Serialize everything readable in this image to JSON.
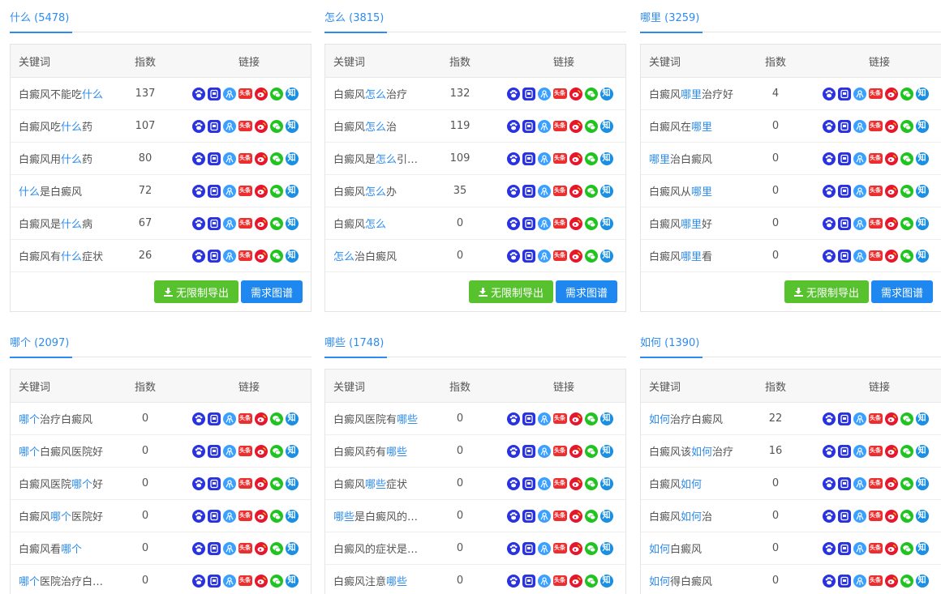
{
  "headers": {
    "keyword": "关键词",
    "index": "指数",
    "links": "链接"
  },
  "buttons": {
    "export": "无限制导出",
    "graph": "需求图谱"
  },
  "icons": [
    "baidu-paw-icon",
    "shenma-icon",
    "360-icon",
    "toutiao-icon",
    "weibo-icon",
    "wechat-icon",
    "zhihu-icon"
  ],
  "icon_glyphs": {
    "toutiao": "头条",
    "zhihu": "知"
  },
  "panels": [
    {
      "tab": "什么 (5478)",
      "term": "什么",
      "rows": [
        {
          "keyword": "白癜风不能吃什么",
          "index": "137"
        },
        {
          "keyword": "白癜风吃什么药",
          "index": "107"
        },
        {
          "keyword": "白癜风用什么药",
          "index": "80"
        },
        {
          "keyword": "什么是白癜风",
          "index": "72"
        },
        {
          "keyword": "白癜风是什么病",
          "index": "67"
        },
        {
          "keyword": "白癜风有什么症状",
          "index": "26"
        }
      ],
      "has_footer": true
    },
    {
      "tab": "怎么 (3815)",
      "term": "怎么",
      "rows": [
        {
          "keyword": "白癜风怎么治疗",
          "index": "132"
        },
        {
          "keyword": "白癜风怎么治",
          "index": "119"
        },
        {
          "keyword": "白癜风是怎么引…",
          "index": "109"
        },
        {
          "keyword": "白癜风怎么办",
          "index": "35"
        },
        {
          "keyword": "白癜风怎么",
          "index": "0"
        },
        {
          "keyword": "怎么治白癜风",
          "index": "0"
        }
      ],
      "has_footer": true
    },
    {
      "tab": "哪里 (3259)",
      "term": "哪里",
      "rows": [
        {
          "keyword": "白癜风哪里治疗好",
          "index": "4"
        },
        {
          "keyword": "白癜风在哪里",
          "index": "0"
        },
        {
          "keyword": "哪里治白癜风",
          "index": "0"
        },
        {
          "keyword": "白癜风从哪里",
          "index": "0"
        },
        {
          "keyword": "白癜风哪里好",
          "index": "0"
        },
        {
          "keyword": "白癜风哪里看",
          "index": "0"
        }
      ],
      "has_footer": true
    },
    {
      "tab": "哪个 (2097)",
      "term": "哪个",
      "rows": [
        {
          "keyword": "哪个治疗白癜风",
          "index": "0"
        },
        {
          "keyword": "哪个白癜风医院好",
          "index": "0"
        },
        {
          "keyword": "白癜风医院哪个好",
          "index": "0"
        },
        {
          "keyword": "白癜风哪个医院好",
          "index": "0"
        },
        {
          "keyword": "白癜风看哪个",
          "index": "0"
        },
        {
          "keyword": "哪个医院治疗白…",
          "index": "0"
        }
      ],
      "has_footer": false
    },
    {
      "tab": "哪些 (1748)",
      "term": "哪些",
      "rows": [
        {
          "keyword": "白癜风医院有哪些",
          "index": "0"
        },
        {
          "keyword": "白癜风药有哪些",
          "index": "0"
        },
        {
          "keyword": "白癜风哪些症状",
          "index": "0"
        },
        {
          "keyword": "哪些是白癜风的…",
          "index": "0"
        },
        {
          "keyword": "白癜风的症状是…",
          "index": "0"
        },
        {
          "keyword": "白癜风注意哪些",
          "index": "0"
        }
      ],
      "has_footer": false
    },
    {
      "tab": "如何 (1390)",
      "term": "如何",
      "rows": [
        {
          "keyword": "如何治疗白癜风",
          "index": "22"
        },
        {
          "keyword": "白癜风该如何治疗",
          "index": "16"
        },
        {
          "keyword": "白癜风如何",
          "index": "0"
        },
        {
          "keyword": "白癜风如何治",
          "index": "0"
        },
        {
          "keyword": "如何白癜风",
          "index": "0"
        },
        {
          "keyword": "如何得白癜风",
          "index": "0"
        }
      ],
      "has_footer": false
    }
  ]
}
